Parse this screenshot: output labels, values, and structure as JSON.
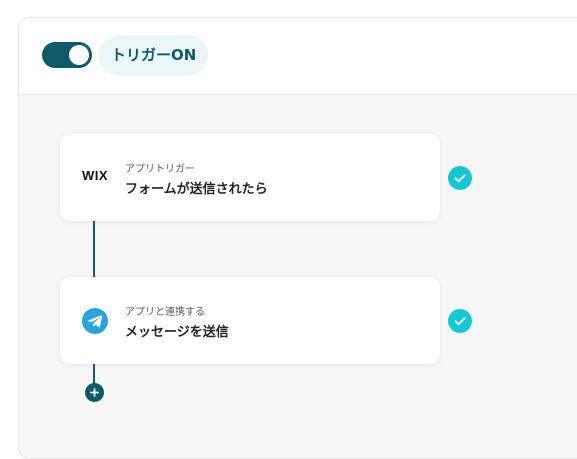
{
  "header": {
    "trigger_toggle_state": "on",
    "trigger_label": "トリガーON"
  },
  "steps": [
    {
      "app_logo": "WIX",
      "app_icon": "wix-logo-icon",
      "category": "アプリトリガー",
      "title": "フォームが送信されたら",
      "status_icon": "check-icon",
      "status": "completed"
    },
    {
      "app_icon": "telegram-icon",
      "category": "アプリと連携する",
      "title": "メッセージを送信",
      "status_icon": "check-icon",
      "status": "completed"
    }
  ],
  "add_step_icon": "plus-icon",
  "colors": {
    "accent": "#0f5a68",
    "check": "#16c7d3",
    "pill_bg": "#eaf6f7",
    "canvas_bg": "#f7f7f7",
    "telegram": "#2aa3dc"
  }
}
